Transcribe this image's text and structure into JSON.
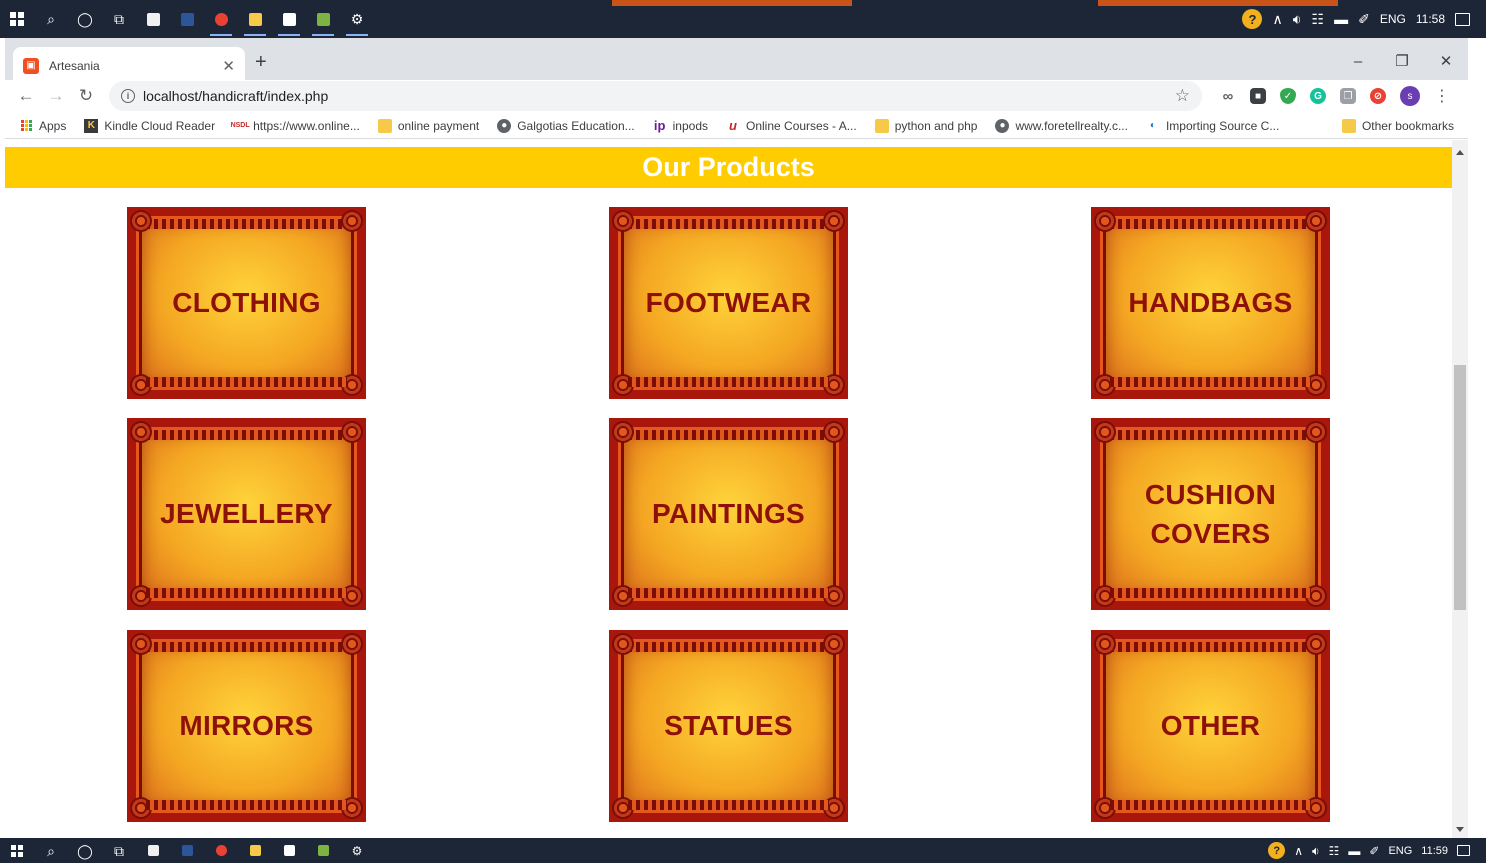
{
  "taskbar": {
    "icons": [
      "windows-logo-icon",
      "search-icon",
      "cortana-icon",
      "task-view-icon",
      "store-icon",
      "word-icon",
      "chrome-icon",
      "file-explorer-icon",
      "notepad-icon",
      "photos-icon",
      "settings-icon"
    ],
    "tray": {
      "lang": "ENG",
      "time_top": "11:58",
      "time_bottom": "11:59"
    }
  },
  "browser": {
    "tab": {
      "title": "Artesania"
    },
    "address": {
      "url": "localhost/handicraft/index.php"
    },
    "bookmarks": [
      {
        "label": "Apps",
        "icon": "apps-grid-icon"
      },
      {
        "label": "Kindle Cloud Reader",
        "icon": "kindle-icon"
      },
      {
        "label": "https://www.online...",
        "icon": "site-icon"
      },
      {
        "label": "online payment",
        "icon": "folder-icon"
      },
      {
        "label": "Galgotias Education...",
        "icon": "globe-icon"
      },
      {
        "label": "inpods",
        "icon": "ip-icon"
      },
      {
        "label": "Online Courses - A...",
        "icon": "udemy-icon"
      },
      {
        "label": "python and php",
        "icon": "folder-icon"
      },
      {
        "label": "www.foretellrealty.c...",
        "icon": "globe-icon"
      },
      {
        "label": "Importing Source C...",
        "icon": "site-icon"
      }
    ],
    "other_bookmarks": "Other bookmarks",
    "avatar_initial": "s"
  },
  "page": {
    "heading": "Our Products",
    "products": [
      {
        "name": "CLOTHING"
      },
      {
        "name": "FOOTWEAR"
      },
      {
        "name": "HANDBAGS"
      },
      {
        "name": "JEWELLERY"
      },
      {
        "name": "PAINTINGS"
      },
      {
        "name": "CUSHION COVERS"
      },
      {
        "name": "MIRRORS"
      },
      {
        "name": "STATUES"
      },
      {
        "name": "OTHER"
      }
    ]
  },
  "colors": {
    "taskbar": "#1d2636",
    "banner": "#ffcc00",
    "card_border": "#a8160c",
    "card_label": "#8e1109"
  }
}
